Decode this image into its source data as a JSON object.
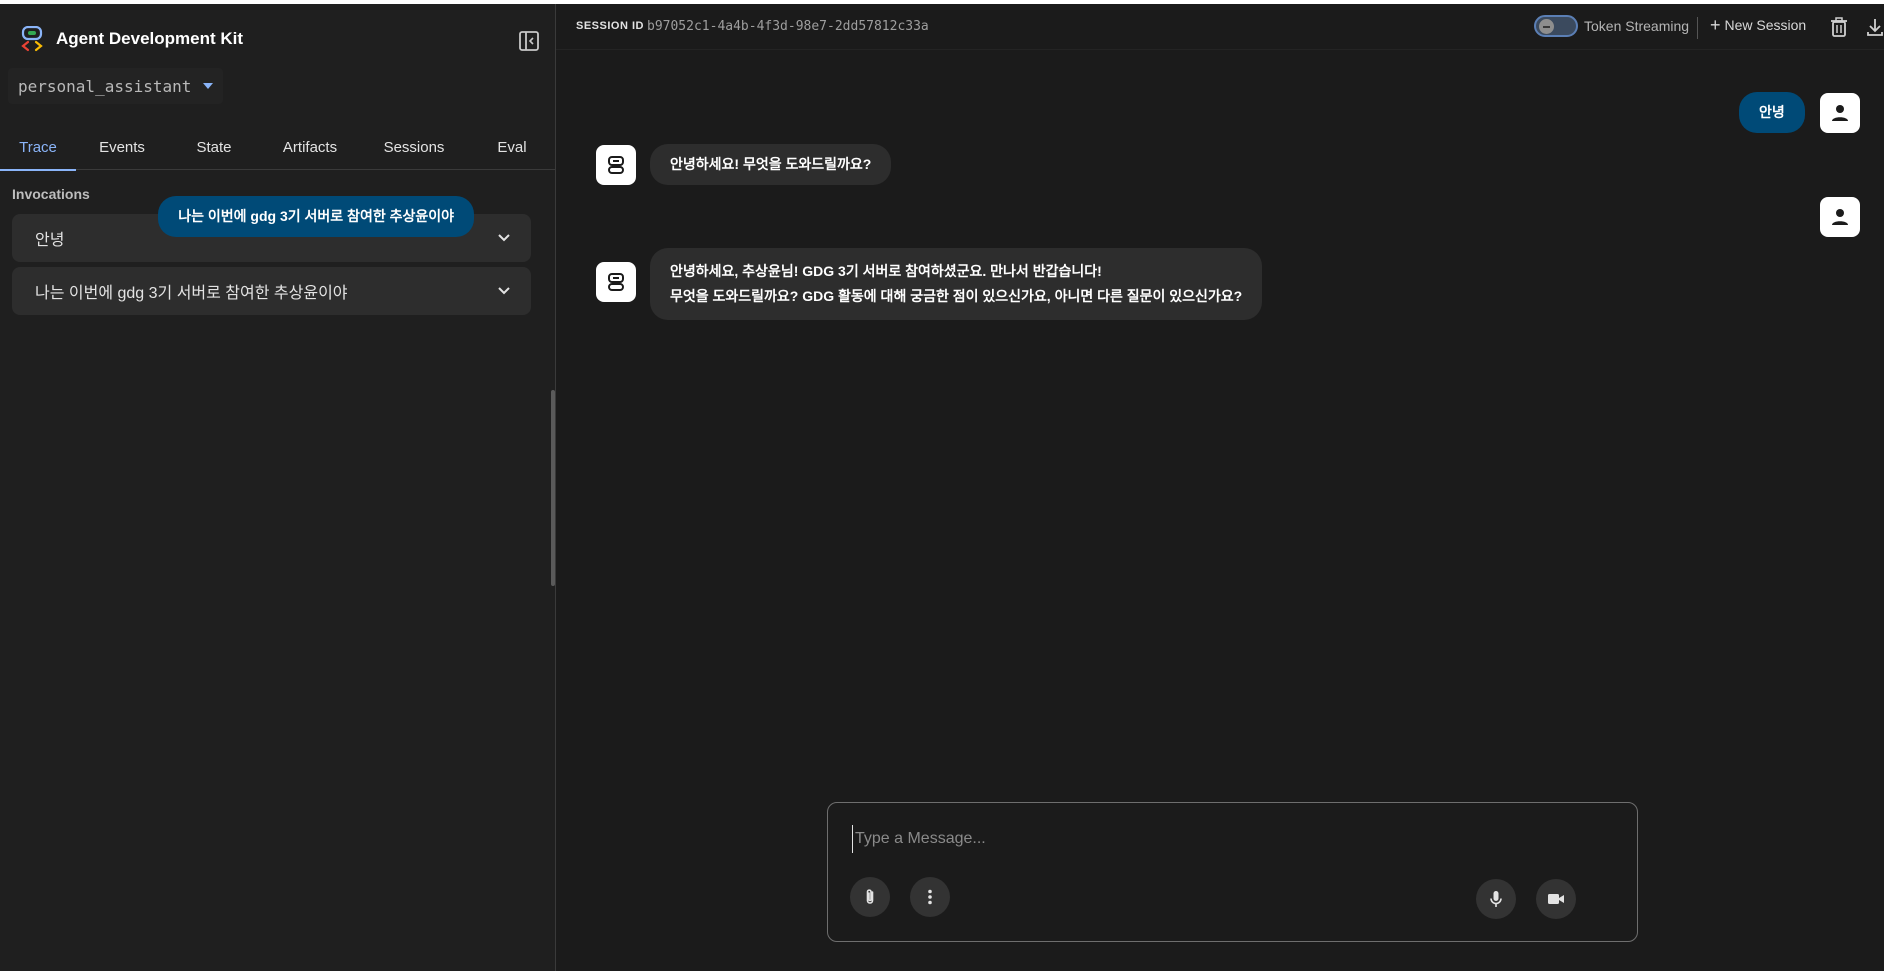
{
  "app": {
    "title": "Agent Development Kit"
  },
  "sidebar": {
    "agent": "personal_assistant",
    "tabs": [
      {
        "label": "Trace",
        "active": true
      },
      {
        "label": "Events",
        "active": false
      },
      {
        "label": "State",
        "active": false
      },
      {
        "label": "Artifacts",
        "active": false
      },
      {
        "label": "Sessions",
        "active": false
      },
      {
        "label": "Eval",
        "active": false
      }
    ],
    "invocations_label": "Invocations",
    "invocations": [
      {
        "text": "안녕"
      },
      {
        "text": "나는 이번에 gdg 3기 서버로 참여한 추상윤이야"
      }
    ]
  },
  "header": {
    "session_label": "SESSION ID",
    "session_id": "b97052c1-4a4b-4f3d-98e7-2dd57812c33a",
    "token_streaming_label": "Token Streaming",
    "token_streaming_on": false,
    "new_session_label": "New Session"
  },
  "messages": [
    {
      "role": "user",
      "lines": [
        "안녕"
      ]
    },
    {
      "role": "bot",
      "lines": [
        "안녕하세요! 무엇을 도와드릴까요?"
      ]
    },
    {
      "role": "user",
      "lines": [
        "나는 이번에 gdg 3기 서버로 참여한 추상윤이야"
      ]
    },
    {
      "role": "bot",
      "lines": [
        "안녕하세요, 추상윤님! GDG 3기 서버로 참여하셨군요. 만나서 반갑습니다!",
        "무엇을 도와드릴까요? GDG 활동에 대해 궁금한 점이 있으신가요, 아니면 다른 질문이 있으신가요?"
      ]
    }
  ],
  "composer": {
    "placeholder": "Type a Message..."
  },
  "colors": {
    "accent": "#8ab4f8",
    "user_bubble": "#004a77",
    "bot_bubble": "#2d2d2d"
  },
  "icons": [
    "adk-logo-icon",
    "sidebar-collapse-icon",
    "chevron-down-icon",
    "plus-icon",
    "trash-icon",
    "download-icon",
    "person-icon",
    "bot-icon",
    "paperclip-icon",
    "more-vert-icon",
    "mic-icon",
    "videocam-icon"
  ]
}
